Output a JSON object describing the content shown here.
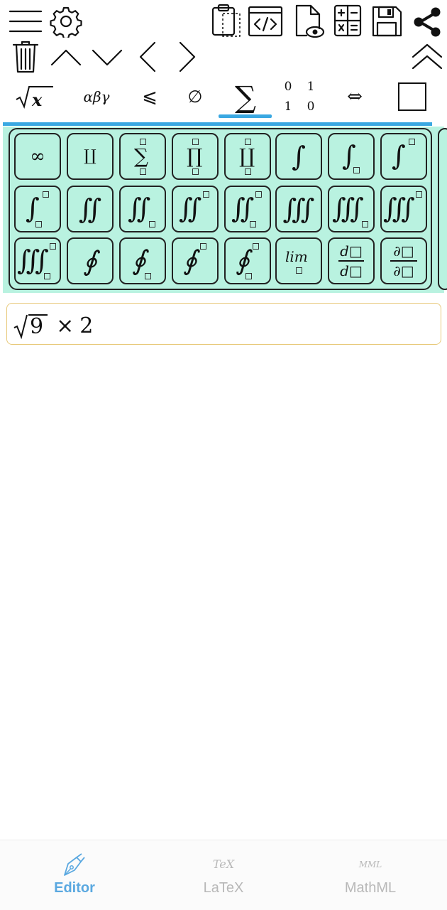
{
  "toolbar": {
    "row1_left": [
      "menu-icon",
      "gear-icon"
    ],
    "row1_right": [
      "clipboard-icon",
      "code-icon",
      "preview-icon",
      "calculator-icon",
      "save-icon",
      "share-icon"
    ],
    "row2": [
      "trash-icon",
      "chevron-up-icon",
      "chevron-down-icon",
      "chevron-left-icon",
      "chevron-right-icon",
      "double-chevron-up-icon"
    ]
  },
  "categories": [
    {
      "label": "√x",
      "name": "root"
    },
    {
      "label": "αβγ",
      "name": "greek"
    },
    {
      "label": "⩽",
      "name": "relations"
    },
    {
      "label": "∅",
      "name": "sets"
    },
    {
      "label": "∑",
      "name": "operators",
      "selected": true
    },
    {
      "label": "0 1 / 1 0",
      "name": "matrix",
      "cells": [
        "0",
        "1",
        "1",
        "0"
      ]
    },
    {
      "label": "⇔",
      "name": "arrows"
    },
    {
      "label": "□",
      "name": "box"
    }
  ],
  "palette": {
    "keys": [
      {
        "name": "infinity",
        "text": "∞"
      },
      {
        "name": "coproduct",
        "text": "∐"
      },
      {
        "name": "sum-limits",
        "text": "∑"
      },
      {
        "name": "product-limits",
        "text": "∏"
      },
      {
        "name": "coproduct-limits",
        "text": "∐"
      },
      {
        "name": "integral",
        "text": "∫"
      },
      {
        "name": "integral-lower",
        "text": "∫"
      },
      {
        "name": "integral-upper",
        "text": "∫"
      },
      {
        "name": "integral-both",
        "text": "∫"
      },
      {
        "name": "double-integral",
        "text": "∬"
      },
      {
        "name": "double-integral-lower",
        "text": "∬"
      },
      {
        "name": "double-integral-upper",
        "text": "∬"
      },
      {
        "name": "double-integral-both",
        "text": "∬"
      },
      {
        "name": "triple-integral",
        "text": "∭"
      },
      {
        "name": "triple-integral-lower",
        "text": "∭"
      },
      {
        "name": "triple-integral-upper",
        "text": "∭"
      },
      {
        "name": "triple-integral-both",
        "text": "∭"
      },
      {
        "name": "contour-integral",
        "text": "∮"
      },
      {
        "name": "contour-integral-lower",
        "text": "∮"
      },
      {
        "name": "contour-integral-upper",
        "text": "∮"
      },
      {
        "name": "contour-integral-both",
        "text": "∮"
      },
      {
        "name": "limit",
        "text": "lim"
      },
      {
        "name": "derivative",
        "numerator": "d□",
        "denominator": "d□"
      },
      {
        "name": "partial-derivative",
        "numerator": "∂□",
        "denominator": "∂□"
      }
    ]
  },
  "editor": {
    "expression_radicand": "9",
    "expression_operator": "×",
    "expression_factor": "2"
  },
  "bottom_nav": {
    "items": [
      {
        "label": "Editor",
        "icon": "pen-icon",
        "active": true
      },
      {
        "label": "LaTeX",
        "icon_text": "TeX",
        "active": false
      },
      {
        "label": "MathML",
        "icon_text": "MML",
        "active": false
      }
    ],
    "active_color": "#5aa8e0",
    "inactive_color": "#b8b8b8"
  },
  "colors": {
    "accent": "#3aa8e2",
    "palette_bg": "#b9f2e0",
    "input_border": "#e8c97a"
  }
}
